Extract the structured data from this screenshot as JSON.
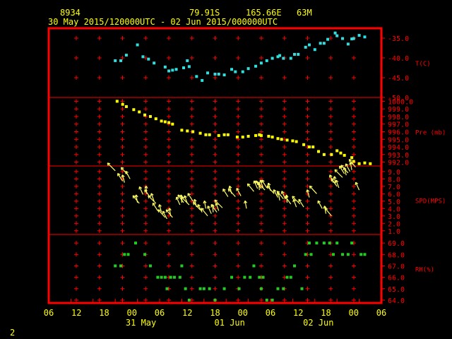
{
  "header": {
    "station": "8934",
    "lat": "79.91S",
    "lon": "165.66E",
    "elev": "63M",
    "range": "30 May 2015/120000UTC - 02 Jun 2015/000000UTC",
    "page": "2"
  },
  "colors": {
    "frame": "#ff0000",
    "temp": "#33dddd",
    "pressure": "#ffff00",
    "wind": "#ffff66",
    "rh": "#22cc22",
    "text": "#ffff00"
  },
  "chart_data": {
    "type": "scatter",
    "x_axis": {
      "range_hours": [
        -6,
        84
      ],
      "tick_hours": [
        -6,
        0,
        6,
        12,
        18,
        24,
        30,
        36,
        42,
        48,
        54,
        60,
        66,
        72,
        78,
        84
      ],
      "tick_labels": [
        "06",
        "12",
        "18",
        "00",
        "06",
        "12",
        "18",
        "00",
        "06",
        "12",
        "18",
        "00",
        "06"
      ],
      "date_labels": [
        "31 May",
        "01 Jun",
        "02 Jun"
      ]
    },
    "panels": [
      {
        "key": "temp",
        "label": "T(C)",
        "ylim": [
          -50,
          -32.5
        ],
        "ticks": [
          -35.0,
          -40.0,
          -45.0,
          -50.0
        ],
        "tick_labels": [
          "-35.0",
          "-40.0",
          "-45.0",
          "-50.0"
        ],
        "points": [
          [
            12,
            -40.7
          ],
          [
            13.5,
            -40.7
          ],
          [
            15,
            -39.3
          ],
          [
            18,
            -36.7
          ],
          [
            19.5,
            -39.7
          ],
          [
            21,
            -40.3
          ],
          [
            22.5,
            -41.3
          ],
          [
            25.5,
            -42.3
          ],
          [
            26.5,
            -43.3
          ],
          [
            27.5,
            -43.1
          ],
          [
            28.5,
            -42.9
          ],
          [
            30.5,
            -42.5
          ],
          [
            31.5,
            -40.7
          ],
          [
            32,
            -42.2
          ],
          [
            34,
            -44.7
          ],
          [
            35.5,
            -45.7
          ],
          [
            37,
            -43.8
          ],
          [
            39,
            -44.1
          ],
          [
            40,
            -44.1
          ],
          [
            41.5,
            -44.3
          ],
          [
            43.5,
            -42.9
          ],
          [
            44.5,
            -43.5
          ],
          [
            46.5,
            -43.5
          ],
          [
            48,
            -42.7
          ],
          [
            50,
            -42.1
          ],
          [
            51.5,
            -41.3
          ],
          [
            53,
            -40.7
          ],
          [
            54.5,
            -40.1
          ],
          [
            56,
            -39.7
          ],
          [
            56.5,
            -39.4
          ],
          [
            57.5,
            -40.1
          ],
          [
            59.5,
            -40.1
          ],
          [
            60.5,
            -39.1
          ],
          [
            61.5,
            -39.1
          ],
          [
            63.5,
            -37.3
          ],
          [
            64.5,
            -36.7
          ],
          [
            66,
            -37.9
          ],
          [
            67.5,
            -36.3
          ],
          [
            68.5,
            -36.3
          ],
          [
            69.5,
            -35.3
          ],
          [
            71.5,
            -33.7
          ],
          [
            72,
            -34.4
          ],
          [
            73.5,
            -35.1
          ],
          [
            75,
            -36.5
          ],
          [
            76,
            -35.2
          ],
          [
            76.5,
            -35.1
          ],
          [
            78,
            -34.3
          ],
          [
            79.5,
            -34.7
          ]
        ]
      },
      {
        "key": "pressure",
        "label": "Pre (mb)",
        "ylim": [
          991.5,
          1000.5
        ],
        "ticks": [
          1000,
          999,
          998,
          997,
          996,
          995,
          994,
          993,
          992
        ],
        "tick_labels": [
          "1000.0",
          "999.0",
          "998.0",
          "997.0",
          "996.0",
          "995.0",
          "994.0",
          "993.0",
          "992.0"
        ],
        "points": [
          [
            12.5,
            1000.0
          ],
          [
            14,
            999.6
          ],
          [
            15,
            999.3
          ],
          [
            17,
            998.9
          ],
          [
            18.5,
            998.6
          ],
          [
            20,
            998.2
          ],
          [
            21.5,
            998.0
          ],
          [
            23,
            997.7
          ],
          [
            24.5,
            997.4
          ],
          [
            25.5,
            997.3
          ],
          [
            26.5,
            997.2
          ],
          [
            27.5,
            997.0
          ],
          [
            30,
            996.2
          ],
          [
            31.5,
            996.1
          ],
          [
            33,
            996.0
          ],
          [
            35,
            995.8
          ],
          [
            36.5,
            995.6
          ],
          [
            37.5,
            995.6
          ],
          [
            40,
            995.5
          ],
          [
            41.5,
            995.6
          ],
          [
            42.5,
            995.6
          ],
          [
            45,
            995.3
          ],
          [
            46.5,
            995.3
          ],
          [
            48,
            995.4
          ],
          [
            50,
            995.5
          ],
          [
            51,
            995.6
          ],
          [
            51.5,
            995.5
          ],
          [
            53.5,
            995.4
          ],
          [
            54.5,
            995.3
          ],
          [
            56,
            995.1
          ],
          [
            57,
            995.0
          ],
          [
            58.5,
            994.9
          ],
          [
            60,
            994.8
          ],
          [
            61,
            994.7
          ],
          [
            63,
            994.3
          ],
          [
            64.5,
            994.0
          ],
          [
            65.5,
            994.0
          ],
          [
            67,
            993.4
          ],
          [
            68.5,
            993.0
          ],
          [
            70.5,
            993.0
          ],
          [
            72,
            993.5
          ],
          [
            73,
            993.2
          ],
          [
            74,
            992.9
          ],
          [
            76,
            992.6
          ],
          [
            76.5,
            992.1
          ],
          [
            78,
            991.8
          ],
          [
            79.5,
            991.9
          ],
          [
            81,
            991.8
          ]
        ]
      },
      {
        "key": "wind",
        "label": "SPD(MPS)",
        "ylim": [
          0.5,
          9.75
        ],
        "ticks": [
          1,
          2,
          3,
          4,
          5,
          6,
          7,
          8,
          9
        ],
        "tick_labels": [
          "1.0",
          "2.0",
          "3.0",
          "4.0",
          "5.0",
          "6.0",
          "7.0",
          "8.0",
          "9.0"
        ],
        "points": [
          [
            12,
            9.1
          ],
          [
            14,
            7.7
          ],
          [
            14.5,
            7.5
          ],
          [
            15.5,
            8.5
          ],
          [
            16,
            8.0
          ],
          [
            18,
            4.8
          ],
          [
            18.5,
            4.7
          ],
          [
            19.5,
            5.9
          ],
          [
            20.5,
            6.0
          ],
          [
            21.5,
            5.5
          ],
          [
            22.5,
            5.0
          ],
          [
            23,
            4.7
          ],
          [
            23.5,
            3.7
          ],
          [
            24.5,
            3.5
          ],
          [
            25.5,
            2.8
          ],
          [
            26,
            2.6
          ],
          [
            27,
            3.0
          ],
          [
            27.5,
            2.8
          ],
          [
            29.5,
            4.5
          ],
          [
            30,
            4.8
          ],
          [
            30.5,
            4.8
          ],
          [
            31.5,
            4.7
          ],
          [
            32,
            4.5
          ],
          [
            33,
            5.0
          ],
          [
            34,
            4.2
          ],
          [
            35,
            3.8
          ],
          [
            35.5,
            3.5
          ],
          [
            36.5,
            4.0
          ],
          [
            37,
            3.0
          ],
          [
            38,
            3.3
          ],
          [
            38.5,
            3.5
          ],
          [
            39.5,
            3.5
          ],
          [
            40,
            3.7
          ],
          [
            41,
            4.1
          ],
          [
            42.5,
            5.6
          ],
          [
            43.5,
            6.0
          ],
          [
            44.5,
            5.6
          ],
          [
            46,
            5.7
          ],
          [
            47.5,
            4.0
          ],
          [
            49.5,
            6.3
          ],
          [
            50.5,
            6.7
          ],
          [
            51,
            6.5
          ],
          [
            51.5,
            6.7
          ],
          [
            52,
            6.8
          ],
          [
            52.5,
            6.5
          ],
          [
            53,
            6.8
          ],
          [
            54,
            6.4
          ],
          [
            55,
            6.0
          ],
          [
            56,
            5.5
          ],
          [
            56.5,
            5.1
          ],
          [
            57.5,
            5.3
          ],
          [
            58,
            5.3
          ],
          [
            58.5,
            4.8
          ],
          [
            59.5,
            4.6
          ],
          [
            61,
            4.2
          ],
          [
            62,
            4.6
          ],
          [
            63,
            4.2
          ],
          [
            64.5,
            5.5
          ],
          [
            66.5,
            6.0
          ],
          [
            68,
            4.0
          ],
          [
            69,
            3.3
          ],
          [
            70.5,
            3.0
          ],
          [
            71,
            7.5
          ],
          [
            71.5,
            7.3
          ],
          [
            72,
            7.0
          ],
          [
            72.5,
            6.8
          ],
          [
            73.5,
            8.2
          ],
          [
            74,
            8.7
          ],
          [
            74.5,
            8.5
          ],
          [
            75,
            8.8
          ],
          [
            75.5,
            9.0
          ],
          [
            76,
            9.2
          ],
          [
            77,
            9.6
          ],
          [
            78,
            6.5
          ]
        ]
      },
      {
        "key": "rh",
        "label": "RH(%)",
        "ylim": [
          63.75,
          69.75
        ],
        "ticks": [
          69,
          68,
          67,
          66,
          65,
          64
        ],
        "tick_labels": [
          "69.0",
          "68.0",
          "67.0",
          "66.0",
          "65.0",
          "64.0"
        ],
        "points": [
          [
            12,
            67
          ],
          [
            13.5,
            67
          ],
          [
            14.5,
            68
          ],
          [
            15.5,
            68
          ],
          [
            17.5,
            69
          ],
          [
            20,
            68
          ],
          [
            21.5,
            67
          ],
          [
            23.5,
            66
          ],
          [
            24.5,
            66
          ],
          [
            25.5,
            66
          ],
          [
            26,
            65
          ],
          [
            27,
            66
          ],
          [
            28,
            66
          ],
          [
            29.5,
            66
          ],
          [
            30,
            67
          ],
          [
            31,
            65
          ],
          [
            32,
            64
          ],
          [
            35,
            65
          ],
          [
            36,
            65
          ],
          [
            37.5,
            65
          ],
          [
            39,
            64
          ],
          [
            41.5,
            65
          ],
          [
            43.5,
            66
          ],
          [
            45.5,
            65
          ],
          [
            47,
            66
          ],
          [
            48.5,
            66
          ],
          [
            49.5,
            67
          ],
          [
            51,
            66
          ],
          [
            51.5,
            65
          ],
          [
            52,
            66
          ],
          [
            53,
            64
          ],
          [
            54.5,
            64
          ],
          [
            56,
            65
          ],
          [
            57.5,
            65
          ],
          [
            58.5,
            66
          ],
          [
            59.5,
            66
          ],
          [
            60.5,
            67
          ],
          [
            62.5,
            65
          ],
          [
            63.5,
            68
          ],
          [
            64.5,
            69
          ],
          [
            65,
            68
          ],
          [
            66.5,
            69
          ],
          [
            68.5,
            69
          ],
          [
            70,
            69
          ],
          [
            71,
            68
          ],
          [
            72,
            69
          ],
          [
            73.5,
            68
          ],
          [
            75,
            68
          ],
          [
            76,
            69
          ],
          [
            78.5,
            68
          ],
          [
            79.5,
            68
          ]
        ]
      }
    ]
  }
}
